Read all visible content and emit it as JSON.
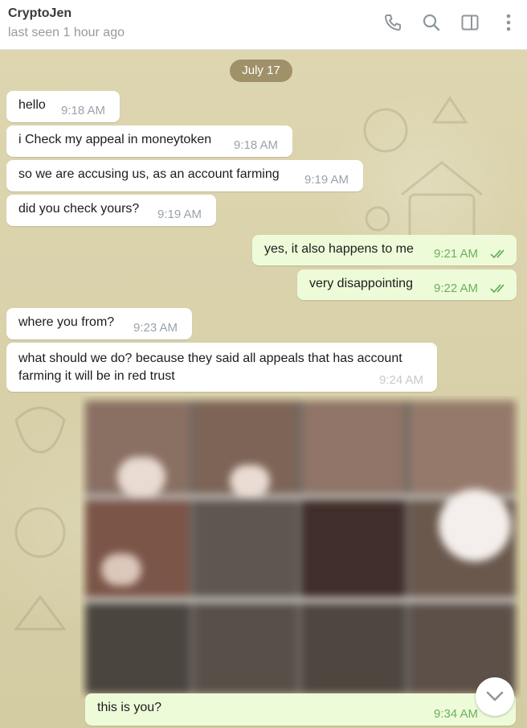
{
  "header": {
    "contact_name": "CryptoJen",
    "status": "last seen 1 hour ago",
    "icons": [
      "phone-icon",
      "search-icon",
      "sidebar-toggle-icon",
      "more-icon"
    ]
  },
  "chat": {
    "date_label": "July 17",
    "messages": [
      {
        "dir": "in",
        "text": "hello",
        "time": "9:18 AM"
      },
      {
        "dir": "in",
        "text": "i Check my appeal in moneytoken",
        "time": "9:18 AM"
      },
      {
        "dir": "in",
        "text": "so we are accusing us, as an account farming",
        "time": "9:19 AM"
      },
      {
        "dir": "in",
        "text": "did you check yours?",
        "time": "9:19 AM"
      },
      {
        "dir": "out",
        "text": "yes, it also happens to me",
        "time": "9:21 AM",
        "read": true
      },
      {
        "dir": "out",
        "text": "very disappointing",
        "time": "9:22 AM",
        "read": true
      },
      {
        "dir": "in",
        "text": "where you from?",
        "time": "9:23 AM"
      },
      {
        "dir": "in",
        "text": "what should we do? because they said all appeals that has account farming it will be in red trust",
        "time": "9:24 AM"
      },
      {
        "dir": "out",
        "text": "this is you?",
        "time": "9:34 AM",
        "has_photo": true
      }
    ]
  },
  "colors": {
    "incoming_bubble": "#ffffff",
    "outgoing_bubble": "#eefbd9",
    "outgoing_time": "#6bb05d",
    "date_pill": "#8c7a52"
  }
}
